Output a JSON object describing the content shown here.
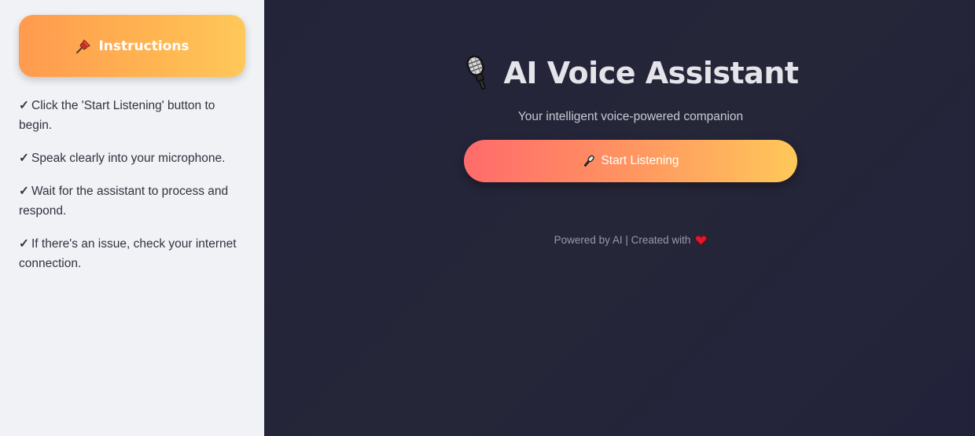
{
  "sidebar": {
    "card_title": "Instructions",
    "card_icon": "pushpin-icon",
    "steps": [
      {
        "mark": "✓",
        "text": "Click the 'Start Listening' button to begin."
      },
      {
        "mark": "✓",
        "text": "Speak clearly into your microphone."
      },
      {
        "mark": "✓",
        "text": "Wait for the assistant to process and respond."
      },
      {
        "mark": "✓",
        "text": "If there's an issue, check your internet connection."
      }
    ]
  },
  "main": {
    "title": "AI Voice Assistant",
    "title_icon": "studio-microphone-icon",
    "subtitle": "Your intelligent voice-powered companion",
    "button_label": "Start Listening",
    "button_icon": "microphone-icon",
    "footer_text": "Powered by AI | Created with",
    "footer_icon": "heart-icon"
  },
  "colors": {
    "sidebar_bg": "#f0f2f6",
    "main_bg": "#24243a",
    "accent_start": "#ff6b6b",
    "accent_end": "#ffc85a",
    "heart": "#e0182b"
  }
}
